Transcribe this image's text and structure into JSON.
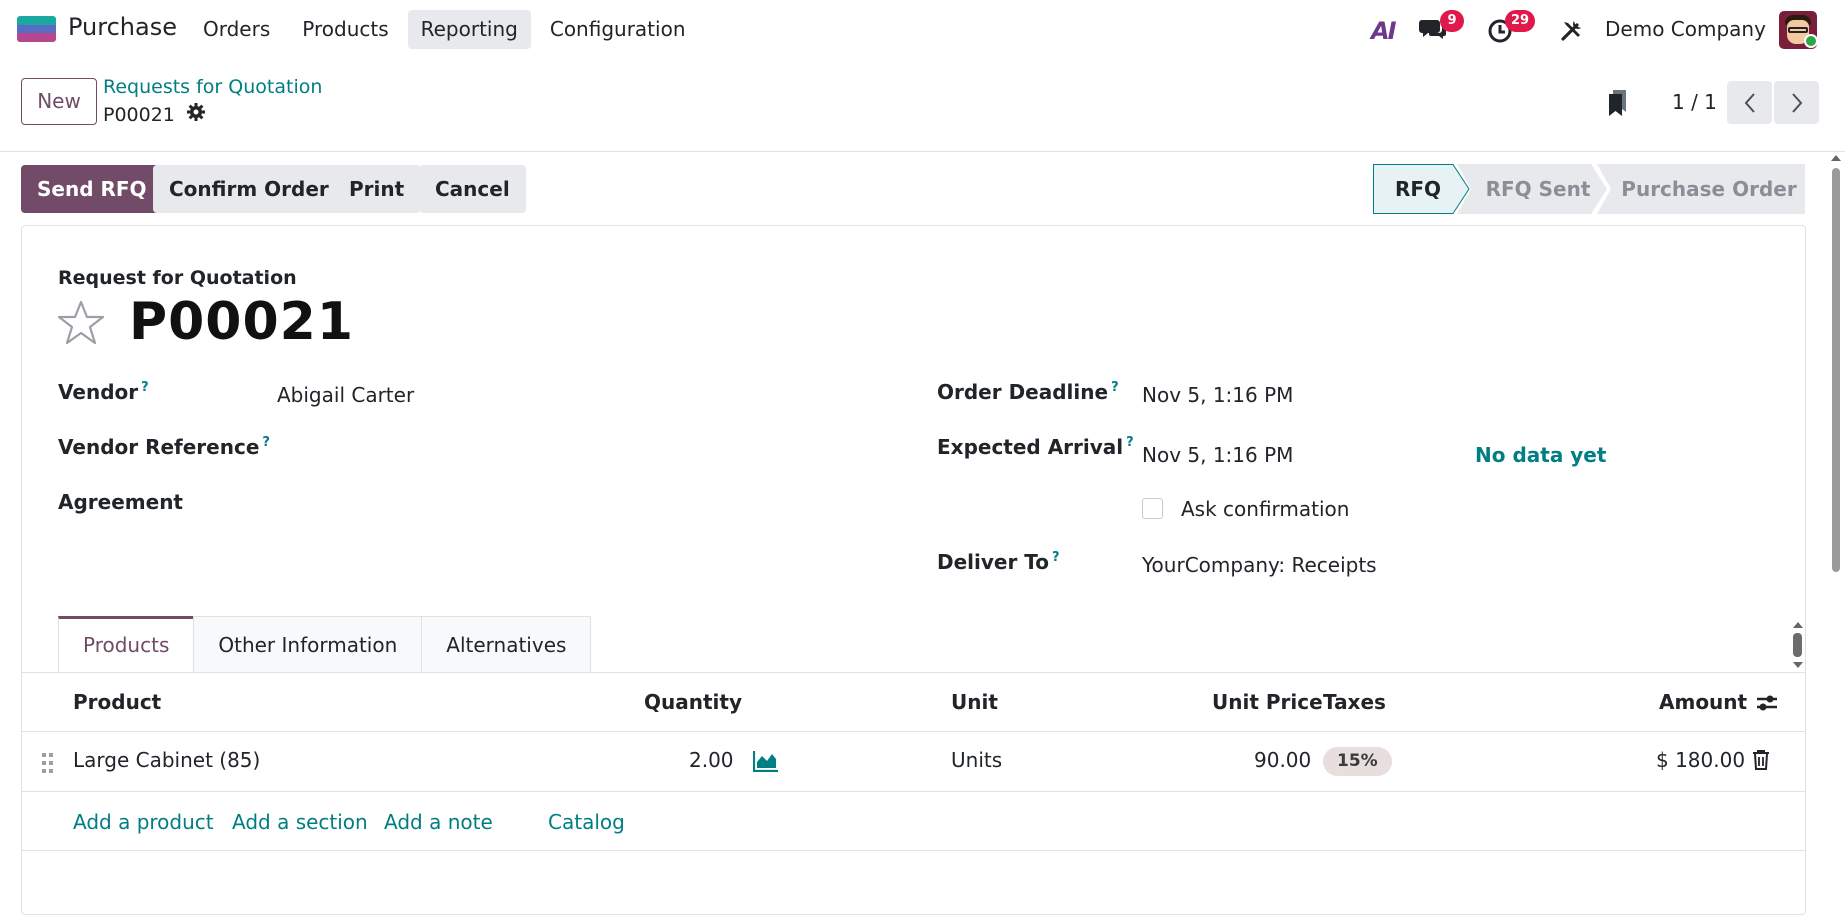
{
  "navbar": {
    "app_name": "Purchase",
    "menu": [
      "Orders",
      "Products",
      "Reporting",
      "Configuration"
    ],
    "active_menu": "Reporting",
    "ai_label": "AI",
    "messages_count": "9",
    "activities_count": "29",
    "company": "Demo Company"
  },
  "control_panel": {
    "new_label": "New",
    "breadcrumb": "Requests for Quotation",
    "record_name": "P00021",
    "pager": "1 / 1"
  },
  "statusbar": {
    "buttons": [
      "Send RFQ",
      "Confirm Order",
      "Print",
      "Cancel"
    ],
    "stages": [
      "RFQ",
      "RFQ Sent",
      "Purchase Order"
    ],
    "current_stage": "RFQ"
  },
  "form": {
    "title_label": "Request for Quotation",
    "title": "P00021",
    "vendor_label": "Vendor",
    "vendor": "Abigail Carter",
    "vendor_ref_label": "Vendor Reference",
    "agreement_label": "Agreement",
    "order_deadline_label": "Order Deadline",
    "order_deadline": "Nov 5, 1:16 PM",
    "expected_arrival_label": "Expected Arrival",
    "expected_arrival": "Nov 5, 1:16 PM",
    "no_data": "No data yet",
    "ask_confirmation_label": "Ask confirmation",
    "ask_confirmation_checked": false,
    "deliver_to_label": "Deliver To",
    "deliver_to": "YourCompany: Receipts",
    "help_mark": "?"
  },
  "tabs": [
    "Products",
    "Other Information",
    "Alternatives"
  ],
  "active_tab": "Products",
  "lines": {
    "headers": {
      "product": "Product",
      "quantity": "Quantity",
      "unit": "Unit",
      "unit_price": "Unit Price",
      "taxes": "Taxes",
      "amount": "Amount"
    },
    "rows": [
      {
        "product": "Large Cabinet (85)",
        "quantity": "2.00",
        "unit": "Units",
        "unit_price": "90.00",
        "taxes": "15%",
        "amount": "$ 180.00"
      }
    ],
    "add_links": [
      "Add a product",
      "Add a section",
      "Add a note",
      "Catalog"
    ]
  },
  "colors": {
    "primary": "#714b67",
    "link": "#017e84",
    "badge": "#e0194a"
  }
}
